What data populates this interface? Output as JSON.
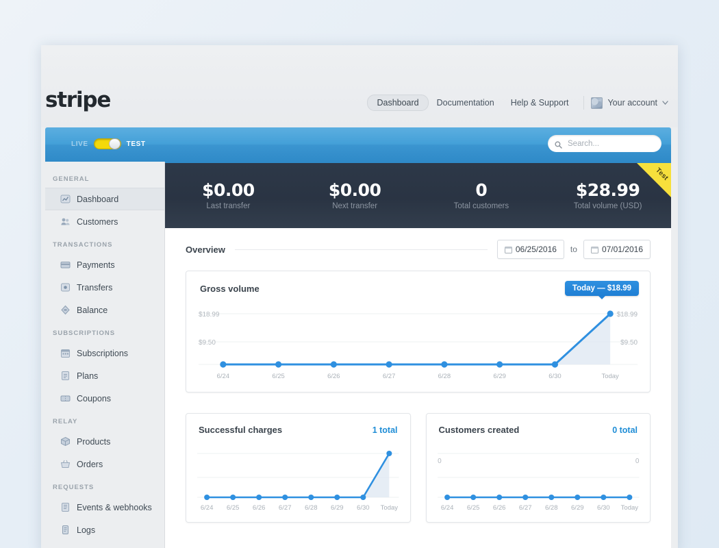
{
  "header": {
    "logo": "stripe",
    "nav": [
      {
        "label": "Dashboard",
        "active": true
      },
      {
        "label": "Documentation",
        "active": false
      },
      {
        "label": "Help & Support",
        "active": false
      }
    ],
    "account_label": "Your account",
    "account_caret": "⌄",
    "avatar_icon": "user-avatar-image"
  },
  "bluebar": {
    "live_label": "LIVE",
    "test_label": "TEST",
    "toggle_state": "test",
    "toggle_color": "#f4d90b",
    "search_placeholder": "Search...",
    "search_value": "",
    "search_icon": "search-icon"
  },
  "sidebar": {
    "groups": [
      {
        "title": "GENERAL",
        "items": [
          {
            "label": "Dashboard",
            "icon": "chart-icon",
            "active": true
          },
          {
            "label": "Customers",
            "icon": "customers-icon",
            "active": false
          }
        ]
      },
      {
        "title": "TRANSACTIONS",
        "items": [
          {
            "label": "Payments",
            "icon": "card-icon",
            "active": false
          },
          {
            "label": "Transfers",
            "icon": "transfer-icon",
            "active": false
          },
          {
            "label": "Balance",
            "icon": "balance-icon",
            "active": false
          }
        ]
      },
      {
        "title": "SUBSCRIPTIONS",
        "items": [
          {
            "label": "Subscriptions",
            "icon": "calendar-icon",
            "active": false
          },
          {
            "label": "Plans",
            "icon": "plan-icon",
            "active": false
          },
          {
            "label": "Coupons",
            "icon": "coupon-icon",
            "active": false
          }
        ]
      },
      {
        "title": "RELAY",
        "items": [
          {
            "label": "Products",
            "icon": "box-icon",
            "active": false
          },
          {
            "label": "Orders",
            "icon": "basket-icon",
            "active": false
          }
        ]
      },
      {
        "title": "REQUESTS",
        "items": [
          {
            "label": "Events & webhooks",
            "icon": "events-icon",
            "active": false
          },
          {
            "label": "Logs",
            "icon": "logs-icon",
            "active": false
          }
        ]
      }
    ]
  },
  "stats": {
    "ribbon_label": "Test",
    "ribbon_color": "#f7e03c",
    "items": [
      {
        "value": "$0.00",
        "label": "Last transfer"
      },
      {
        "value": "$0.00",
        "label": "Next transfer"
      },
      {
        "value": "0",
        "label": "Total customers"
      },
      {
        "value": "$28.99",
        "label": "Total volume (USD)"
      }
    ]
  },
  "overview": {
    "title": "Overview",
    "date_from": "06/25/2016",
    "date_to_label": "to",
    "date_to": "07/01/2016",
    "calendar_icon": "calendar-icon"
  },
  "chart_data": [
    {
      "type": "line",
      "name": "gross-volume",
      "title": "Gross volume",
      "tooltip": "Today — $18.99",
      "categories": [
        "6/24",
        "6/25",
        "6/26",
        "6/27",
        "6/28",
        "6/29",
        "6/30",
        "Today"
      ],
      "values": [
        0,
        0,
        0,
        0,
        0,
        0,
        0,
        18.99
      ],
      "ylim": [
        0,
        18.99
      ],
      "ytick_labels_left": [
        "$18.99",
        "$9.50"
      ],
      "ytick_labels_right": [
        "$18.99",
        "$9.50"
      ],
      "ytick_values": [
        18.99,
        9.5
      ],
      "grid": true,
      "legend": "none",
      "accent_color": "#2f90e0",
      "xlabel": "",
      "ylabel": ""
    },
    {
      "type": "line",
      "name": "successful-charges",
      "title": "Successful charges",
      "total_label": "1 total",
      "categories": [
        "6/24",
        "6/25",
        "6/26",
        "6/27",
        "6/28",
        "6/29",
        "6/30",
        "Today"
      ],
      "values": [
        0,
        0,
        0,
        0,
        0,
        0,
        0,
        1
      ],
      "ylim": [
        0,
        1
      ],
      "ytick_labels_left": [],
      "ytick_labels_right": [],
      "grid": true,
      "legend": "none",
      "accent_color": "#2f90e0",
      "xlabel": "",
      "ylabel": ""
    },
    {
      "type": "line",
      "name": "customers-created",
      "title": "Customers created",
      "total_label": "0 total",
      "categories": [
        "6/24",
        "6/25",
        "6/26",
        "6/27",
        "6/28",
        "6/29",
        "6/30",
        "Today"
      ],
      "values": [
        0,
        0,
        0,
        0,
        0,
        0,
        0,
        0
      ],
      "ylim": [
        0,
        0
      ],
      "ytick_labels_left": [
        "0"
      ],
      "ytick_labels_right": [
        "0"
      ],
      "grid": true,
      "legend": "none",
      "accent_color": "#2f90e0",
      "xlabel": "",
      "ylabel": ""
    }
  ]
}
